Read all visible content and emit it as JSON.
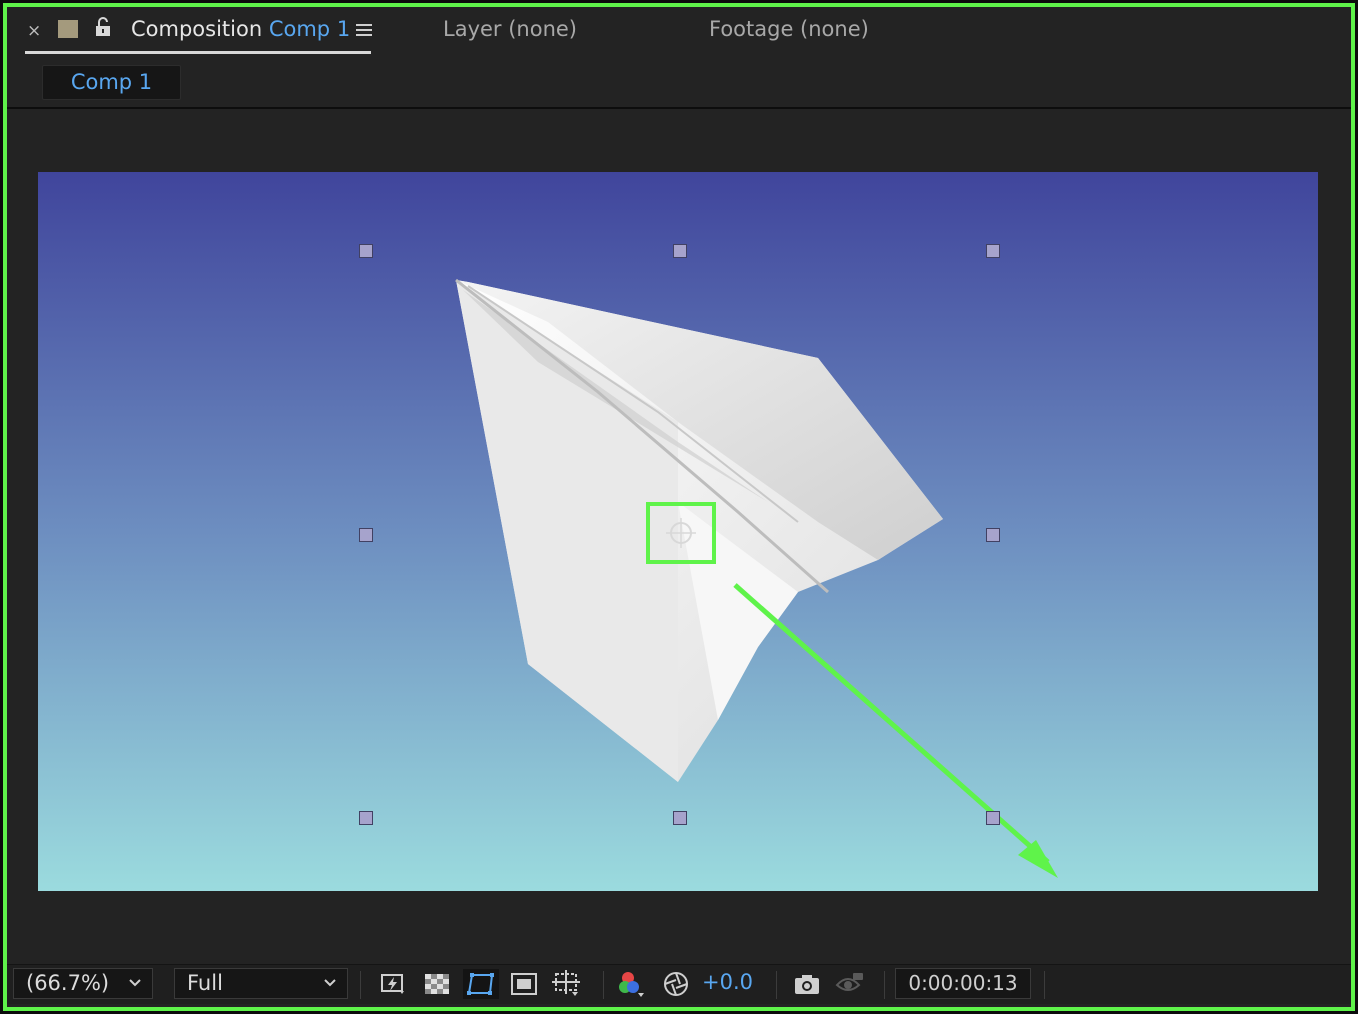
{
  "tabs": {
    "close_symbol": "×",
    "composition_label": "Composition",
    "composition_name": "Comp 1",
    "layer_tab": "Layer (none)",
    "footage_tab": "Footage (none)",
    "subtab": "Comp 1"
  },
  "viewer": {
    "background_top": "#40459c",
    "background_bottom": "#9bdbde",
    "subject": "paper airplane"
  },
  "bottombar": {
    "zoom": "(66.7%)",
    "resolution": "Full",
    "exposure": "+0.0",
    "timecode": "0:00:00:13"
  },
  "colors": {
    "accent": "#59a7f0",
    "highlight": "#5ff34a"
  },
  "icons": [
    "close-icon",
    "label-swatch-icon",
    "lock-icon",
    "panel-menu-icon",
    "chevron-down-icon",
    "fast-previews-icon",
    "transparency-grid-icon",
    "mask-path-visibility-icon",
    "region-of-interest-icon",
    "toggle-guides-icon",
    "channel-icon",
    "exposure-icon",
    "snapshot-camera-icon",
    "show-snapshot-icon"
  ]
}
